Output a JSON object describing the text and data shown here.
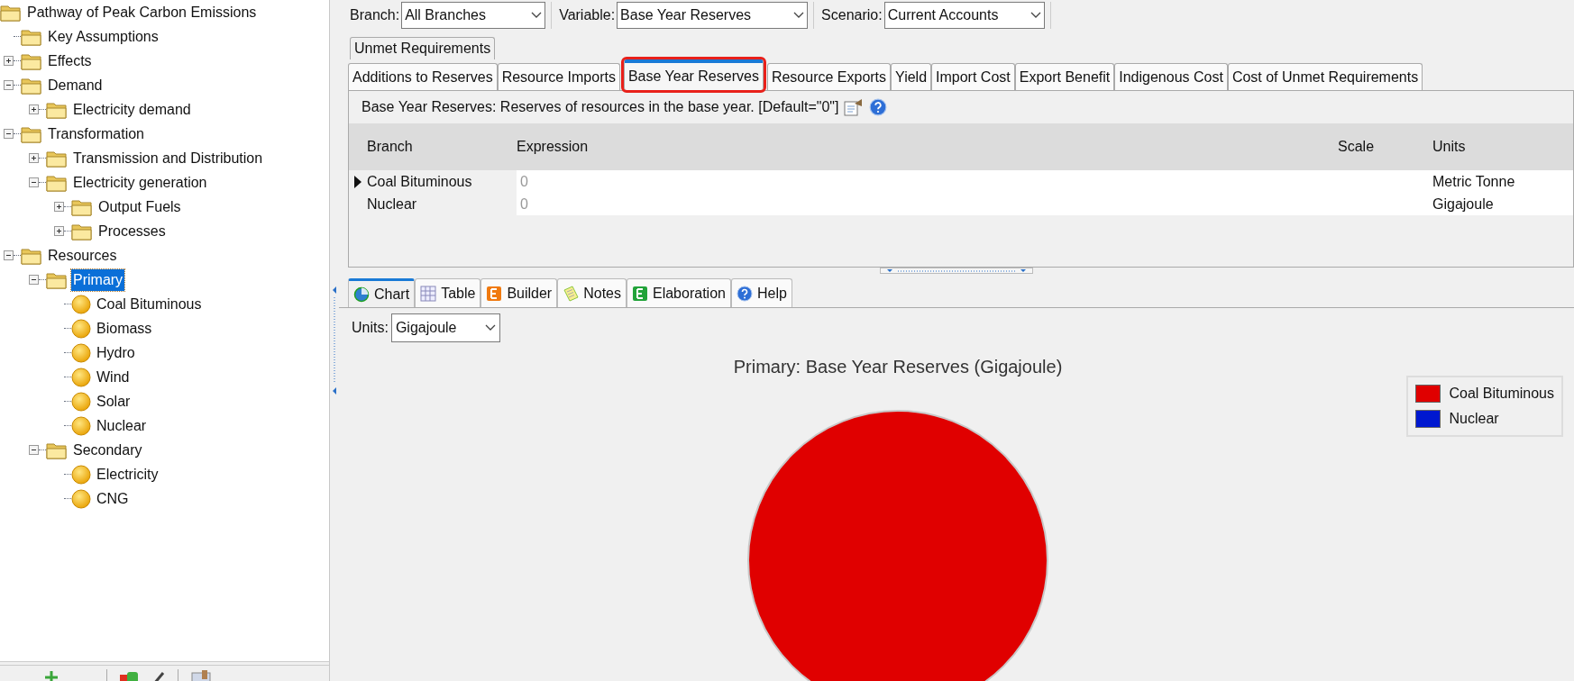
{
  "tree": [
    {
      "label": "Pathway of Peak Carbon Emissions",
      "kind": "folder",
      "selected": false,
      "children": [
        {
          "label": "Key Assumptions",
          "kind": "folder",
          "selected": false
        },
        {
          "label": "Effects",
          "kind": "folder",
          "selected": false,
          "expanded": false
        },
        {
          "label": "Demand",
          "kind": "folder",
          "selected": false,
          "expanded": true,
          "children": [
            {
              "label": "Electricity demand",
              "kind": "folder",
              "selected": false,
              "expanded": false
            }
          ]
        },
        {
          "label": "Transformation",
          "kind": "folder",
          "selected": false,
          "expanded": true,
          "children": [
            {
              "label": "Transmission and Distribution",
              "kind": "folder",
              "selected": false,
              "expanded": false
            },
            {
              "label": "Electricity generation",
              "kind": "folder",
              "selected": false,
              "expanded": true,
              "children": [
                {
                  "label": "Output Fuels",
                  "kind": "folder",
                  "selected": false,
                  "expanded": false
                },
                {
                  "label": "Processes",
                  "kind": "folder",
                  "selected": false,
                  "expanded": false
                }
              ]
            }
          ]
        },
        {
          "label": "Resources",
          "kind": "folder",
          "selected": false,
          "expanded": true,
          "children": [
            {
              "label": "Primary",
              "kind": "folder",
              "selected": true,
              "expanded": true,
              "children": [
                {
                  "label": "Coal Bituminous",
                  "kind": "fuel",
                  "selected": false
                },
                {
                  "label": "Biomass",
                  "kind": "fuel",
                  "selected": false
                },
                {
                  "label": "Hydro",
                  "kind": "fuel",
                  "selected": false
                },
                {
                  "label": "Wind",
                  "kind": "fuel",
                  "selected": false
                },
                {
                  "label": "Solar",
                  "kind": "fuel",
                  "selected": false
                },
                {
                  "label": "Nuclear",
                  "kind": "fuel",
                  "selected": false
                }
              ]
            },
            {
              "label": "Secondary",
              "kind": "folder",
              "selected": false,
              "expanded": true,
              "children": [
                {
                  "label": "Electricity",
                  "kind": "fuel",
                  "selected": false
                },
                {
                  "label": "CNG",
                  "kind": "fuel",
                  "selected": false
                }
              ]
            }
          ]
        }
      ]
    }
  ],
  "selectors": [
    {
      "label": "Branch:",
      "value": "All Branches"
    },
    {
      "label": "Variable:",
      "value": "Base Year Reserves"
    },
    {
      "label": "Scenario:",
      "value": "Current Accounts"
    }
  ],
  "variable_tabs": [
    [
      {
        "label": "Unmet Requirements",
        "selected": false
      }
    ],
    [
      {
        "label": "Additions to Reserves",
        "selected": false
      },
      {
        "label": "Resource Imports",
        "selected": false
      },
      {
        "label": "Base Year Reserves",
        "selected": true
      },
      {
        "label": "Resource Exports",
        "selected": false
      },
      {
        "label": "Yield",
        "selected": false
      },
      {
        "label": "Import Cost",
        "selected": false
      },
      {
        "label": "Export Benefit",
        "selected": false
      },
      {
        "label": "Indigenous Cost",
        "selected": false
      },
      {
        "label": "Cost of Unmet Requirements",
        "selected": false
      }
    ]
  ],
  "description": "Base Year Reserves: Reserves of resources in the base year. [Default=\"0\"]",
  "table": {
    "columns": [
      "Branch",
      "Expression",
      "Scale",
      "Units"
    ],
    "rows": [
      {
        "branch": "Coal Bituminous",
        "expression": "0",
        "units": "Metric Tonne",
        "selected": true
      },
      {
        "branch": "Nuclear",
        "expression": "0",
        "units": "Gigajoule",
        "selected": false
      }
    ]
  },
  "view_tabs": [
    {
      "label": "Chart",
      "kind": "chart",
      "selected": true
    },
    {
      "label": "Table",
      "kind": "table",
      "selected": false
    },
    {
      "label": "Builder",
      "kind": "builder",
      "selected": false
    },
    {
      "label": "Notes",
      "kind": "notes",
      "selected": false
    },
    {
      "label": "Elaboration",
      "kind": "elaboration",
      "selected": false
    },
    {
      "label": "Help",
      "kind": "help",
      "selected": false
    }
  ],
  "units": {
    "label": "Units:",
    "value": "Gigajoule"
  },
  "chart": {
    "title": "Primary: Base Year Reserves (Gigajoule)",
    "legend": [
      {
        "label": "Coal Bituminous",
        "color": "#e00000"
      },
      {
        "label": "Nuclear",
        "color": "#0018d0"
      }
    ]
  }
}
